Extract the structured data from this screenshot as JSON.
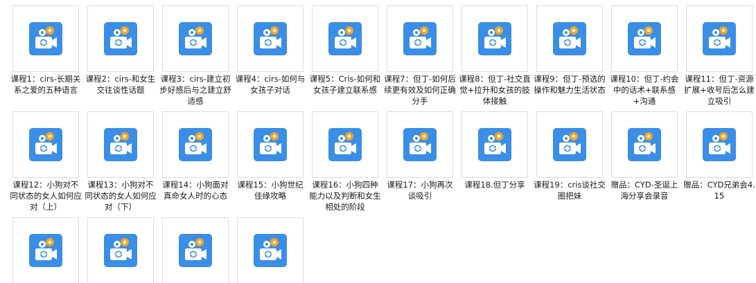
{
  "icon_name": "video-file-icon",
  "colors": {
    "icon_bg": "#3a8ee6",
    "icon_camera": "#ffffff",
    "icon_reel": "#f5a623",
    "frame_border": "#dcdcdc",
    "label_text": "#1a1a1a"
  },
  "files": [
    {
      "name": "课程1：cirs-长期关系之爱的五种语言"
    },
    {
      "name": "课程2：cirs-和女生交往谈性话题"
    },
    {
      "name": "课程3：cirs-建立初步好感后与之建立舒适感"
    },
    {
      "name": "课程4：cirs-如何与女孩子对话"
    },
    {
      "name": "课程5：Cris-如何和女孩子建立联系感"
    },
    {
      "name": "课程7：但丁-如何后续更有效及如何正确分手"
    },
    {
      "name": "课程8：但丁-社交直觉+拉升和女孩的肢体接触"
    },
    {
      "name": "课程9：但丁-预选的操作和魅力生活状态"
    },
    {
      "name": "课程10：但丁-约会中的话术+联系感+沟通"
    },
    {
      "name": "课程11：但丁-资源扩展+收号后怎么建立吸引"
    },
    {
      "name": "课程12：小狗对不同状态的女人如何应对（上）"
    },
    {
      "name": "课程13：小狗对不同状态的女人如何应对（下）"
    },
    {
      "name": "课程14：小狗面对真命女人时的心态"
    },
    {
      "name": "课程15：小狗世纪佳缘攻略"
    },
    {
      "name": "课程16：小狗四种能力以及判断和女生相处的阶段"
    },
    {
      "name": "课程17：小狗再次谈吸引"
    },
    {
      "name": "课程18.但丁分享"
    },
    {
      "name": "课程19：cris谈社交圈把妹"
    },
    {
      "name": "赠品：CYD-圣诞上海分享会录音"
    },
    {
      "name": "赠品：CYD兄弟会4.15"
    },
    {
      "name": ""
    },
    {
      "name": ""
    },
    {
      "name": ""
    },
    {
      "name": ""
    }
  ]
}
